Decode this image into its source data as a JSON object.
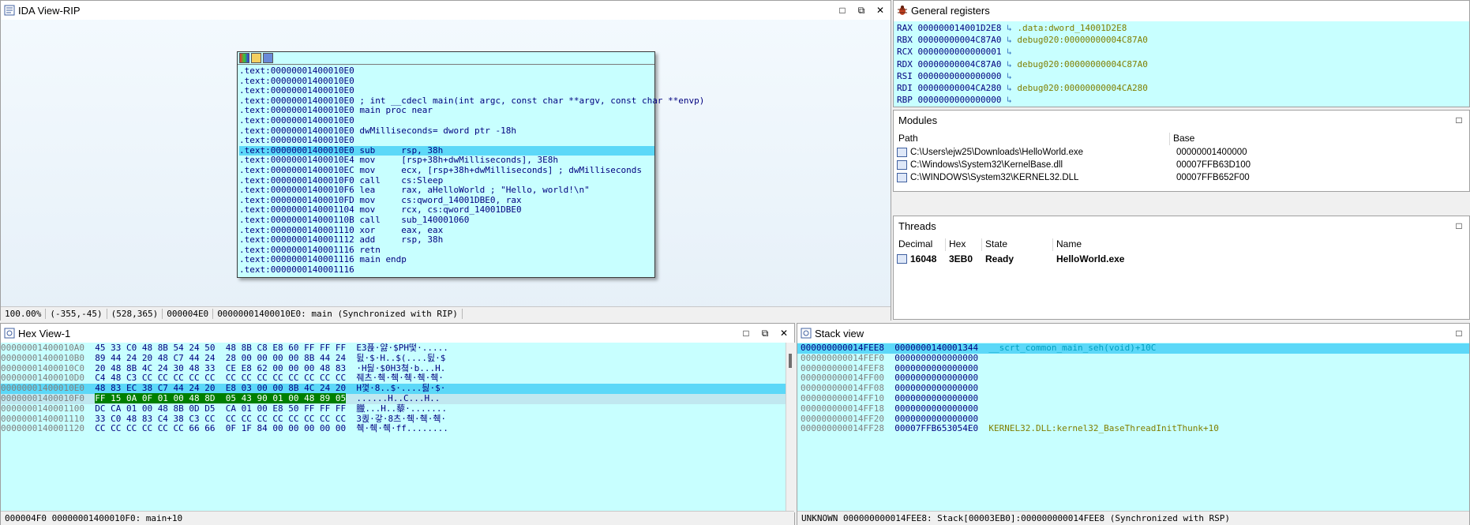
{
  "ida_view": {
    "title": "IDA View-RIP",
    "graph_lines": [
      {
        "addr": ".text:00000001400010E0",
        "text": "",
        "hl": false
      },
      {
        "addr": ".text:00000001400010E0",
        "text": "",
        "hl": false
      },
      {
        "addr": ".text:00000001400010E0",
        "text": "",
        "hl": false
      },
      {
        "addr": ".text:00000001400010E0",
        "text": " ; int __cdecl main(int argc, const char **argv, const char **envp)",
        "hl": false
      },
      {
        "addr": ".text:00000001400010E0",
        "text": " main proc near",
        "hl": false
      },
      {
        "addr": ".text:00000001400010E0",
        "text": "",
        "hl": false
      },
      {
        "addr": ".text:00000001400010E0",
        "text": " dwMilliseconds= dword ptr -18h",
        "hl": false
      },
      {
        "addr": ".text:00000001400010E0",
        "text": "",
        "hl": false
      },
      {
        "addr": ".text:00000001400010E0",
        "text": " sub     rsp, 38h",
        "hl": true
      },
      {
        "addr": ".text:00000001400010E4",
        "text": " mov     [rsp+38h+dwMilliseconds], 3E8h",
        "hl": false
      },
      {
        "addr": ".text:00000001400010EC",
        "text": " mov     ecx, [rsp+38h+dwMilliseconds] ; dwMilliseconds",
        "hl": false
      },
      {
        "addr": ".text:00000001400010F0",
        "text": " call    cs:Sleep",
        "hl": false
      },
      {
        "addr": ".text:00000001400010F6",
        "text": " lea     rax, aHelloWorld ; \"Hello, world!\\n\"",
        "hl": false
      },
      {
        "addr": ".text:00000001400010FD",
        "text": " mov     cs:qword_14001DBE0, rax",
        "hl": false
      },
      {
        "addr": ".text:0000000140001104",
        "text": " mov     rcx, cs:qword_14001DBE0",
        "hl": false
      },
      {
        "addr": ".text:000000014000110B",
        "text": " call    sub_140001060",
        "hl": false
      },
      {
        "addr": ".text:0000000140001110",
        "text": " xor     eax, eax",
        "hl": false
      },
      {
        "addr": ".text:0000000140001112",
        "text": " add     rsp, 38h",
        "hl": false
      },
      {
        "addr": ".text:0000000140001116",
        "text": " retn",
        "hl": false
      },
      {
        "addr": ".text:0000000140001116",
        "text": " main endp",
        "hl": false
      },
      {
        "addr": ".text:0000000140001116",
        "text": "",
        "hl": false
      }
    ],
    "status": [
      "100.00%",
      "(-355,-45)",
      "(528,365)",
      "000004E0",
      "00000001400010E0: main (Synchronized with RIP)"
    ]
  },
  "registers": {
    "title": "General registers",
    "rows": [
      {
        "name": "RAX",
        "value": "000000014001D2E8",
        "ref": ".data:dword_14001D2E8"
      },
      {
        "name": "RBX",
        "value": "00000000004C87A0",
        "ref": "debug020:00000000004C87A0"
      },
      {
        "name": "RCX",
        "value": "0000000000000001",
        "ref": ""
      },
      {
        "name": "RDX",
        "value": "00000000004C87A0",
        "ref": "debug020:00000000004C87A0"
      },
      {
        "name": "RSI",
        "value": "0000000000000000",
        "ref": ""
      },
      {
        "name": "RDI",
        "value": "00000000004CA280",
        "ref": "debug020:00000000004CA280"
      },
      {
        "name": "RBP",
        "value": "0000000000000000",
        "ref": ""
      }
    ]
  },
  "modules": {
    "title": "Modules",
    "col_path": "Path",
    "col_base": "Base",
    "rows": [
      {
        "path": "C:\\Users\\ejw25\\Downloads\\HelloWorld.exe",
        "base": "00000001400000"
      },
      {
        "path": "C:\\Windows\\System32\\KernelBase.dll",
        "base": "00007FFB63D100"
      },
      {
        "path": "C:\\WINDOWS\\System32\\KERNEL32.DLL",
        "base": "00007FFB652F00"
      }
    ]
  },
  "threads": {
    "title": "Threads",
    "cols": [
      "Decimal",
      "Hex",
      "State",
      "Name"
    ],
    "rows": [
      {
        "decimal": "16048",
        "hex": "3EB0",
        "state": "Ready",
        "name": "HelloWorld.exe"
      }
    ]
  },
  "hex_view": {
    "title": "Hex View-1",
    "rows": [
      {
        "addr": "00000001400010A0",
        "bytes": "45 33 C0 48 8B 54 24 50  48 8B C8 E8 60 FF FF FF",
        "ascii": "E3퓭·얋·$PH떷·.....",
        "hl": ""
      },
      {
        "addr": "00000001400010B0",
        "bytes": "89 44 24 20 48 C7 44 24  28 00 00 00 00 8B 44 24",
        "ascii": "딄·$·H..$(....딄·$",
        "hl": ""
      },
      {
        "addr": "00000001400010C0",
        "bytes": "20 48 8B 4C 24 30 48 33  CE E8 62 00 00 00 48 83",
        "ascii": "·H딇·$0H3쳨·b...H.",
        "hl": ""
      },
      {
        "addr": "00000001400010D0",
        "bytes": "C4 48 C3 CC CC CC CC CC  CC CC CC CC CC CC CC CC",
        "ascii": "줴츠·췍·췍·췍·췍·췍·",
        "hl": ""
      },
      {
        "addr": "00000001400010E0",
        "bytes": "48 83 EC 38 C7 44 24 20  E8 03 00 00 8B 4C 24 20",
        "ascii": "H껓·8..$·....딇·$·",
        "hl": "line"
      },
      {
        "addr": "00000001400010F0",
        "bytes": "FF 15 0A 0F 01 00 48 8D  05 43 90 01 00 48 89 05",
        "ascii": "......H..C...H..",
        "hl": "cur"
      },
      {
        "addr": "0000000140001100",
        "bytes": "DC CA 01 00 48 8B 0D D5  CA 01 00 E8 50 FF FF FF",
        "ascii": "臘...H..藜·.......",
        "hl": ""
      },
      {
        "addr": "0000000140001110",
        "bytes": "33 C0 48 83 C4 38 C3 CC  CC CC CC CC CC CC CC CC",
        "ascii": "3퀹·갛·8츠·췍·췍·췍·",
        "hl": ""
      },
      {
        "addr": "0000000140001120",
        "bytes": "CC CC CC CC CC CC 66 66  0F 1F 84 00 00 00 00 00",
        "ascii": "췍·췍·췍·ff........",
        "hl": ""
      }
    ],
    "status": "000004F0 00000001400010F0: main+10"
  },
  "stack_view": {
    "title": "Stack view",
    "rows": [
      {
        "addr": "000000000014FEE8",
        "value": "0000000140001344",
        "ref": "__scrt_common_main_seh(void)+10C",
        "hl": true
      },
      {
        "addr": "000000000014FEF0",
        "value": "0000000000000000",
        "ref": "",
        "hl": false
      },
      {
        "addr": "000000000014FEF8",
        "value": "0000000000000000",
        "ref": "",
        "hl": false
      },
      {
        "addr": "000000000014FF00",
        "value": "0000000000000000",
        "ref": "",
        "hl": false
      },
      {
        "addr": "000000000014FF08",
        "value": "0000000000000000",
        "ref": "",
        "hl": false
      },
      {
        "addr": "000000000014FF10",
        "value": "0000000000000000",
        "ref": "",
        "hl": false
      },
      {
        "addr": "000000000014FF18",
        "value": "0000000000000000",
        "ref": "",
        "hl": false
      },
      {
        "addr": "000000000014FF20",
        "value": "0000000000000000",
        "ref": "",
        "hl": false
      },
      {
        "addr": "000000000014FF28",
        "value": "00007FFB653054E0",
        "ref": "KERNEL32.DLL:kernel32_BaseThreadInitThunk+10",
        "hl": false
      }
    ],
    "status": "UNKNOWN 000000000014FEE8: Stack[00003EB0]:000000000014FEE8 (Synchronized with RSP)"
  },
  "colors": {
    "cyan_bg": "#c8ffff",
    "highlight": "#5cd8f8",
    "hex_current": "#007f00"
  }
}
